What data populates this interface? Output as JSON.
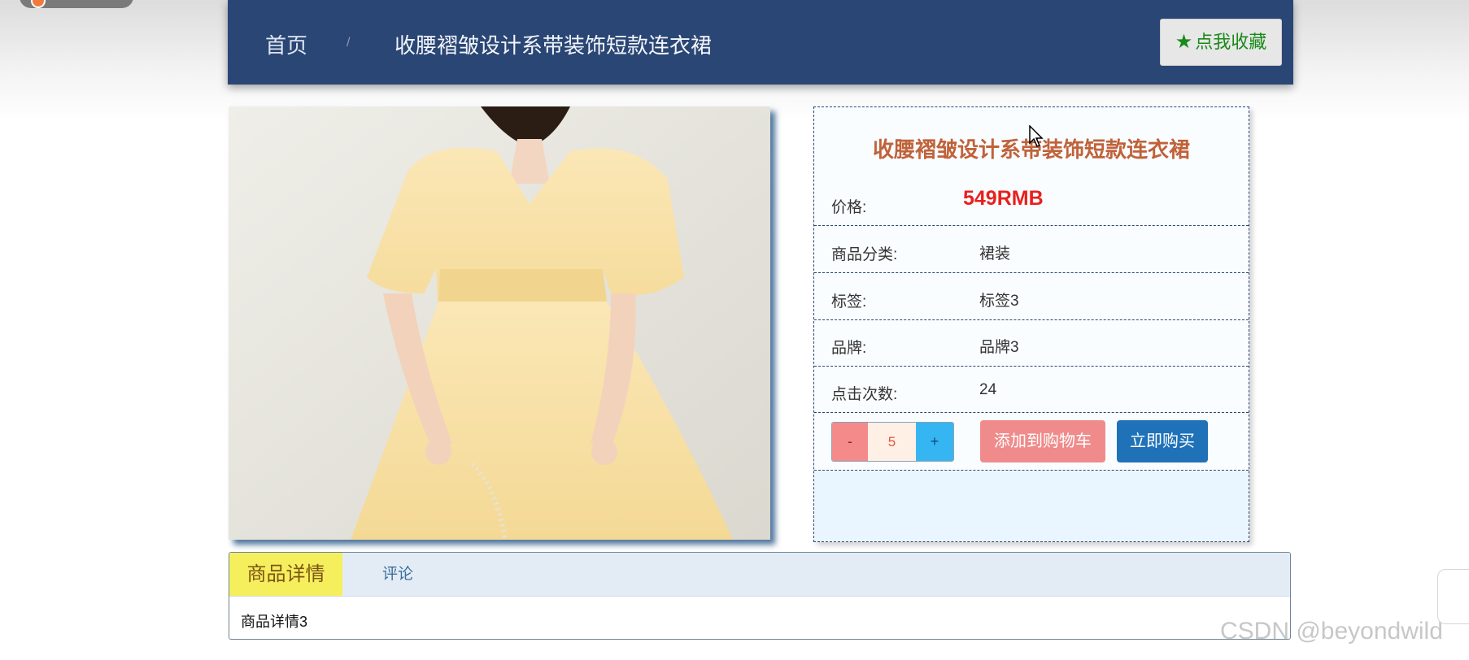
{
  "header": {
    "home_label": "首页",
    "separator": "/",
    "current_label": "收腰褶皱设计系带装饰短款连衣裙",
    "favorite_button": "点我收藏",
    "favorite_icon": "star-icon"
  },
  "product": {
    "image_alt": "product-photo-yellow-dress",
    "title": "收腰褶皱设计系带装饰短款连衣裙",
    "price_label": "价格:",
    "price_value": "549RMB",
    "category_label": "商品分类:",
    "category_value": "裙装",
    "tag_label": "标签:",
    "tag_value": "标签3",
    "brand_label": "品牌:",
    "brand_value": "品牌3",
    "clicks_label": "点击次数:",
    "clicks_value": "24"
  },
  "actions": {
    "minus_label": "-",
    "quantity": "5",
    "plus_label": "+",
    "add_to_cart": "添加到购物车",
    "buy_now": "立即购买"
  },
  "tabs": {
    "detail_label": "商品详情",
    "comment_label": "评论",
    "detail_content": "商品详情3"
  },
  "watermark": "CSDN @beyondwild",
  "colors": {
    "header_bg": "#2a4674",
    "title_color": "#c0623a",
    "price_color": "#e8201c",
    "cart_button": "#f08b8b",
    "buy_button": "#1f72b8",
    "active_tab": "#f6ef5d"
  }
}
